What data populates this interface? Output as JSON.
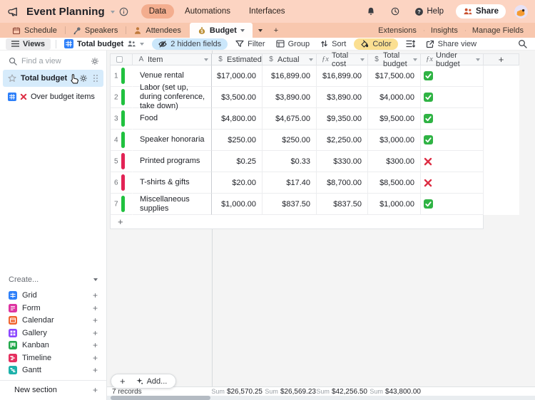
{
  "topbar": {
    "title": "Event Planning",
    "nav": [
      {
        "label": "Data",
        "active": true
      },
      {
        "label": "Automations",
        "active": false
      },
      {
        "label": "Interfaces",
        "active": false
      }
    ],
    "help": "Help",
    "share": "Share"
  },
  "tabbar": {
    "tabs": [
      {
        "label": "Schedule",
        "active": false
      },
      {
        "label": "Speakers",
        "active": false
      },
      {
        "label": "Attendees",
        "active": false
      },
      {
        "label": "Budget",
        "active": true
      }
    ],
    "right_links": [
      "Extensions",
      "Insights",
      "Manage Fields"
    ]
  },
  "toolbar": {
    "views": "Views",
    "current_view": "Total budget",
    "hidden_fields": "2 hidden fields",
    "filter": "Filter",
    "group": "Group",
    "sort": "Sort",
    "color": "Color",
    "share_view": "Share view"
  },
  "sidebar": {
    "search_placeholder": "Find a view",
    "views": [
      {
        "label": "Total budget",
        "selected": true
      },
      {
        "label": "Over budget items",
        "selected": false
      }
    ],
    "create": "Create...",
    "create_items": [
      {
        "label": "Grid",
        "color": "#2d7ff9"
      },
      {
        "label": "Form",
        "color": "#dd34a2"
      },
      {
        "label": "Calendar",
        "color": "#f0642f"
      },
      {
        "label": "Gallery",
        "color": "#8b46ff"
      },
      {
        "label": "Kanban",
        "color": "#24a94c"
      },
      {
        "label": "Timeline",
        "color": "#e5305f"
      },
      {
        "label": "Gantt",
        "color": "#1db1aa"
      }
    ],
    "new_section": "New section"
  },
  "grid": {
    "columns": [
      {
        "name": "Item",
        "type": "text"
      },
      {
        "name": "Estimated",
        "type": "currency"
      },
      {
        "name": "Actual",
        "type": "currency"
      },
      {
        "name": "Total cost",
        "type": "formula"
      },
      {
        "name": "Total budget",
        "type": "currency"
      },
      {
        "name": "Under budget",
        "type": "formula"
      }
    ],
    "rows": [
      {
        "num": "1",
        "bar": "green",
        "item": "Venue rental",
        "estimated": "$17,000.00",
        "actual": "$16,899.00",
        "total_cost": "$16,899.00",
        "total_budget": "$17,500.00",
        "under_budget": true
      },
      {
        "num": "2",
        "bar": "green",
        "item": "Labor (set up, during conference, take down)",
        "estimated": "$3,500.00",
        "actual": "$3,890.00",
        "total_cost": "$3,890.00",
        "total_budget": "$4,000.00",
        "under_budget": true
      },
      {
        "num": "3",
        "bar": "green",
        "item": "Food",
        "estimated": "$4,800.00",
        "actual": "$4,675.00",
        "total_cost": "$9,350.00",
        "total_budget": "$9,500.00",
        "under_budget": true
      },
      {
        "num": "4",
        "bar": "green",
        "item": "Speaker honoraria",
        "estimated": "$250.00",
        "actual": "$250.00",
        "total_cost": "$2,250.00",
        "total_budget": "$3,000.00",
        "under_budget": true
      },
      {
        "num": "5",
        "bar": "red",
        "item": "Printed programs",
        "estimated": "$0.25",
        "actual": "$0.33",
        "total_cost": "$330.00",
        "total_budget": "$300.00",
        "under_budget": false
      },
      {
        "num": "6",
        "bar": "red",
        "item": "T-shirts & gifts",
        "estimated": "$20.00",
        "actual": "$17.40",
        "total_cost": "$8,700.00",
        "total_budget": "$8,500.00",
        "under_budget": false
      },
      {
        "num": "7",
        "bar": "green",
        "item": "Miscellaneous supplies",
        "estimated": "$1,000.00",
        "actual": "$837.50",
        "total_cost": "$837.50",
        "total_budget": "$1,000.00",
        "under_budget": true
      }
    ],
    "add_button": "Add...",
    "record_count": "7 records",
    "sum_label": "Sum",
    "sums": {
      "estimated": "$26,570.25",
      "actual": "$26,569.23",
      "total_cost": "$42,256.50",
      "total_budget": "$43,800.00"
    }
  }
}
